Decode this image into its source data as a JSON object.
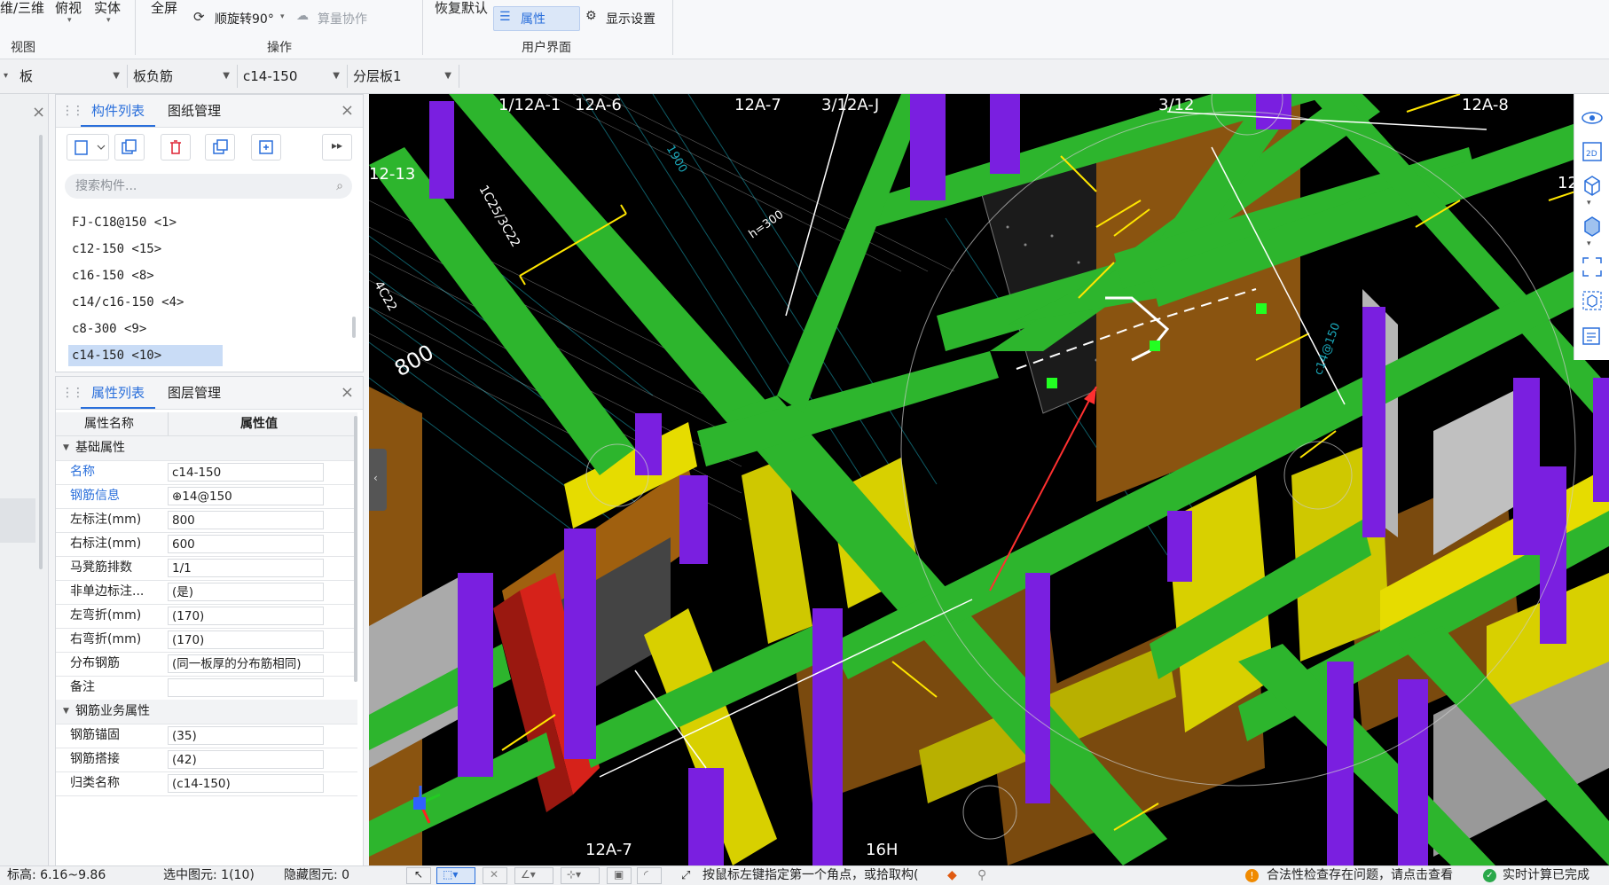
{
  "ribbon": {
    "view_group": {
      "label": "视图",
      "btn_2d3d": "维/三维",
      "btn_top": "俯视",
      "btn_solid": "实体"
    },
    "ops_group": {
      "label": "操作",
      "btn_fullscreen": "全屏",
      "btn_rotate": "顺旋转90°",
      "btn_collab": "算量协作"
    },
    "ui_group": {
      "label": "用户界面",
      "btn_restore": "恢复默认",
      "btn_props": "属性",
      "btn_display": "显示设置"
    }
  },
  "filter_bar": {
    "floor": "板",
    "type": "板负筋",
    "component": "c14-150",
    "layer": "分层板1"
  },
  "component_panel": {
    "tab_list": "构件列表",
    "tab_drawings": "图纸管理",
    "search_placeholder": "搜索构件...",
    "items": [
      {
        "label": "FJ-C18@150 <1>"
      },
      {
        "label": "c12-150 <15>"
      },
      {
        "label": "c16-150 <8>"
      },
      {
        "label": "c14/c16-150 <4>"
      },
      {
        "label": "c8-300 <9>"
      },
      {
        "label": "c14-150 <10>"
      }
    ]
  },
  "property_panel": {
    "tab_props": "属性列表",
    "tab_layers": "图层管理",
    "col_name": "属性名称",
    "col_value": "属性值",
    "group_basic": "基础属性",
    "rows": [
      {
        "name": "名称",
        "value": "c14-150"
      },
      {
        "name": "钢筋信息",
        "value": "⊕14@150"
      },
      {
        "name": "左标注(mm)",
        "value": "800"
      },
      {
        "name": "右标注(mm)",
        "value": "600"
      },
      {
        "name": "马凳筋排数",
        "value": "1/1"
      },
      {
        "name": "非单边标注...",
        "value": "(是)"
      },
      {
        "name": "左弯折(mm)",
        "value": "(170)"
      },
      {
        "name": "右弯折(mm)",
        "value": "(170)"
      },
      {
        "name": "分布钢筋",
        "value": "(同一板厚的分布筋相同)"
      },
      {
        "name": "备注",
        "value": ""
      }
    ],
    "group_rebar": "钢筋业务属性",
    "rows2": [
      {
        "name": "钢筋锚固",
        "value": "(35)"
      },
      {
        "name": "钢筋搭接",
        "value": "(42)"
      },
      {
        "name": "归类名称",
        "value": "(c14-150)"
      }
    ]
  },
  "viewport": {
    "axis_labels": [
      "1/12A-1",
      "12A-6",
      "12A-7",
      "3/12A-J",
      "3/12",
      "12A-8",
      "12-13",
      "12A-7",
      "16H",
      "12"
    ],
    "measurement": "800",
    "annotations": [
      "h=300",
      "c14@150",
      "1900",
      "1C25/3C22",
      "4C22"
    ]
  },
  "status_bar": {
    "elevation": "标高: 6.16~9.86",
    "selected": "选中图元: 1(10)",
    "hidden": "隐藏图元: 0",
    "hint": "按鼠标左键指定第一个角点，或拾取构(",
    "check_msg": "合法性检查存在问题，请点击查看",
    "calc_msg": "实时计算已完成"
  },
  "colors": {
    "accent": "#2a6fdb",
    "beam_green": "#2db52d",
    "column_purple": "#7a1fe0",
    "wall_yellow": "#d8d000",
    "slab_brown": "#8a5410"
  }
}
